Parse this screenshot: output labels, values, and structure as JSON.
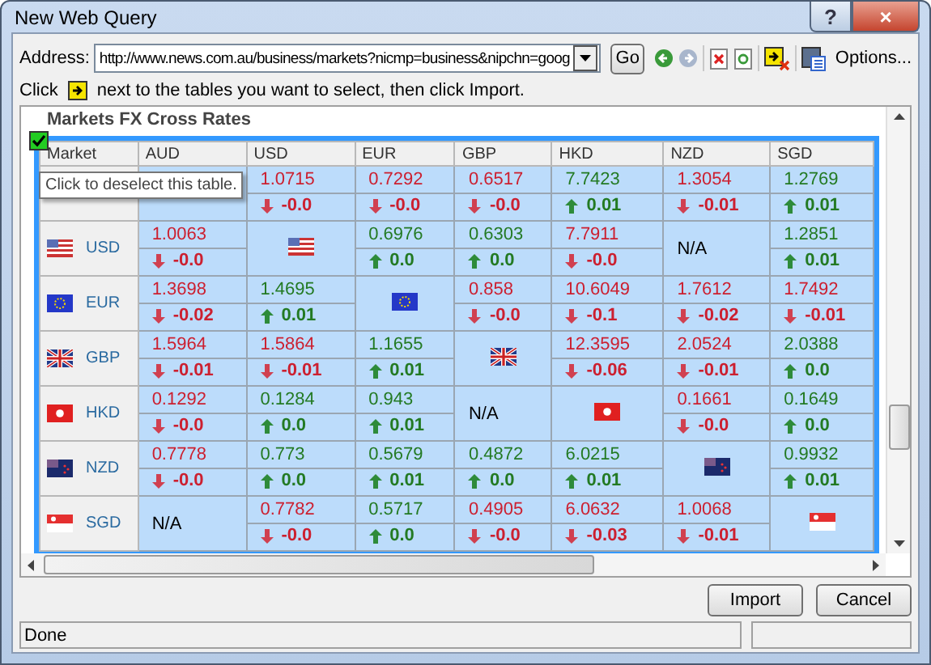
{
  "window": {
    "title": "New Web Query",
    "help_button": "?",
    "close_button": "×"
  },
  "address": {
    "label": "Address:",
    "value": "http://www.news.com.au/business/markets?nicmp=business&nipchn=goog",
    "go_button": "Go",
    "options_button": "Options..."
  },
  "hint": {
    "before": "Click",
    "after": "next to the tables you want to select, then click Import."
  },
  "page": {
    "heading": "Markets FX Cross Rates",
    "table": {
      "selected": true,
      "tooltip": "Click to deselect this table.",
      "columns": [
        "Market",
        "AUD",
        "USD",
        "EUR",
        "GBP",
        "HKD",
        "NZD",
        "SGD"
      ],
      "rows": [
        {
          "cells": [
            {
              "kind": "blank"
            },
            {
              "kind": "blank"
            },
            {
              "kind": "rate",
              "value": "1.0715",
              "change": "-0.0",
              "up": false
            },
            {
              "kind": "rate",
              "value": "0.7292",
              "change": "-0.0",
              "up": false
            },
            {
              "kind": "rate",
              "value": "0.6517",
              "change": "-0.0",
              "up": false
            },
            {
              "kind": "rate",
              "value": "7.7423",
              "change": "0.01",
              "up": true
            },
            {
              "kind": "rate",
              "value": "1.3054",
              "change": "-0.01",
              "up": false
            },
            {
              "kind": "rate",
              "value": "1.2769",
              "change": "0.01",
              "up": true
            }
          ]
        },
        {
          "cells": [
            {
              "kind": "market",
              "label": "USD"
            },
            {
              "kind": "rate",
              "value": "1.0063",
              "change": "-0.0",
              "up": false
            },
            {
              "kind": "flag"
            },
            {
              "kind": "rate",
              "value": "0.6976",
              "change": "0.0",
              "up": true
            },
            {
              "kind": "rate",
              "value": "0.6303",
              "change": "0.0",
              "up": true
            },
            {
              "kind": "rate",
              "value": "7.7911",
              "change": "-0.0",
              "up": false
            },
            {
              "kind": "na",
              "text": "N/A"
            },
            {
              "kind": "rate",
              "value": "1.2851",
              "change": "0.01",
              "up": true
            }
          ]
        },
        {
          "cells": [
            {
              "kind": "market",
              "label": "EUR"
            },
            {
              "kind": "rate",
              "value": "1.3698",
              "change": "-0.02",
              "up": false
            },
            {
              "kind": "rate",
              "value": "1.4695",
              "change": "0.01",
              "up": true
            },
            {
              "kind": "flag"
            },
            {
              "kind": "rate",
              "value": "0.858",
              "change": "-0.0",
              "up": false
            },
            {
              "kind": "rate",
              "value": "10.6049",
              "change": "-0.1",
              "up": false
            },
            {
              "kind": "rate",
              "value": "1.7612",
              "change": "-0.02",
              "up": false
            },
            {
              "kind": "rate",
              "value": "1.7492",
              "change": "-0.01",
              "up": false
            }
          ]
        },
        {
          "cells": [
            {
              "kind": "market",
              "label": "GBP"
            },
            {
              "kind": "rate",
              "value": "1.5964",
              "change": "-0.01",
              "up": false
            },
            {
              "kind": "rate",
              "value": "1.5864",
              "change": "-0.01",
              "up": false
            },
            {
              "kind": "rate",
              "value": "1.1655",
              "change": "0.01",
              "up": true
            },
            {
              "kind": "flag"
            },
            {
              "kind": "rate",
              "value": "12.3595",
              "change": "-0.06",
              "up": false
            },
            {
              "kind": "rate",
              "value": "2.0524",
              "change": "-0.01",
              "up": false
            },
            {
              "kind": "rate",
              "value": "2.0388",
              "change": "0.0",
              "up": true
            }
          ]
        },
        {
          "cells": [
            {
              "kind": "market",
              "label": "HKD"
            },
            {
              "kind": "rate",
              "value": "0.1292",
              "change": "-0.0",
              "up": false
            },
            {
              "kind": "rate",
              "value": "0.1284",
              "change": "0.0",
              "up": true
            },
            {
              "kind": "rate",
              "value": "0.943",
              "change": "0.01",
              "up": true
            },
            {
              "kind": "na",
              "text": "N/A"
            },
            {
              "kind": "flag"
            },
            {
              "kind": "rate",
              "value": "0.1661",
              "change": "-0.0",
              "up": false
            },
            {
              "kind": "rate",
              "value": "0.1649",
              "change": "0.0",
              "up": true
            }
          ]
        },
        {
          "cells": [
            {
              "kind": "market",
              "label": "NZD"
            },
            {
              "kind": "rate",
              "value": "0.7778",
              "change": "-0.0",
              "up": false
            },
            {
              "kind": "rate",
              "value": "0.773",
              "change": "0.0",
              "up": true
            },
            {
              "kind": "rate",
              "value": "0.5679",
              "change": "0.01",
              "up": true
            },
            {
              "kind": "rate",
              "value": "0.4872",
              "change": "0.0",
              "up": true
            },
            {
              "kind": "rate",
              "value": "6.0215",
              "change": "0.01",
              "up": true
            },
            {
              "kind": "flag"
            },
            {
              "kind": "rate",
              "value": "0.9932",
              "change": "0.01",
              "up": true
            }
          ]
        },
        {
          "cells": [
            {
              "kind": "market",
              "label": "SGD"
            },
            {
              "kind": "na",
              "text": "N/A"
            },
            {
              "kind": "rate",
              "value": "0.7782",
              "change": "-0.0",
              "up": false
            },
            {
              "kind": "rate",
              "value": "0.5717",
              "change": "0.0",
              "up": true
            },
            {
              "kind": "rate",
              "value": "0.4905",
              "change": "-0.0",
              "up": false
            },
            {
              "kind": "rate",
              "value": "6.0632",
              "change": "-0.03",
              "up": false
            },
            {
              "kind": "rate",
              "value": "1.0068",
              "change": "-0.01",
              "up": false
            },
            {
              "kind": "flag"
            }
          ]
        }
      ]
    }
  },
  "buttons": [
    "Import",
    "Cancel"
  ],
  "status_bar": {
    "text": "Done"
  }
}
